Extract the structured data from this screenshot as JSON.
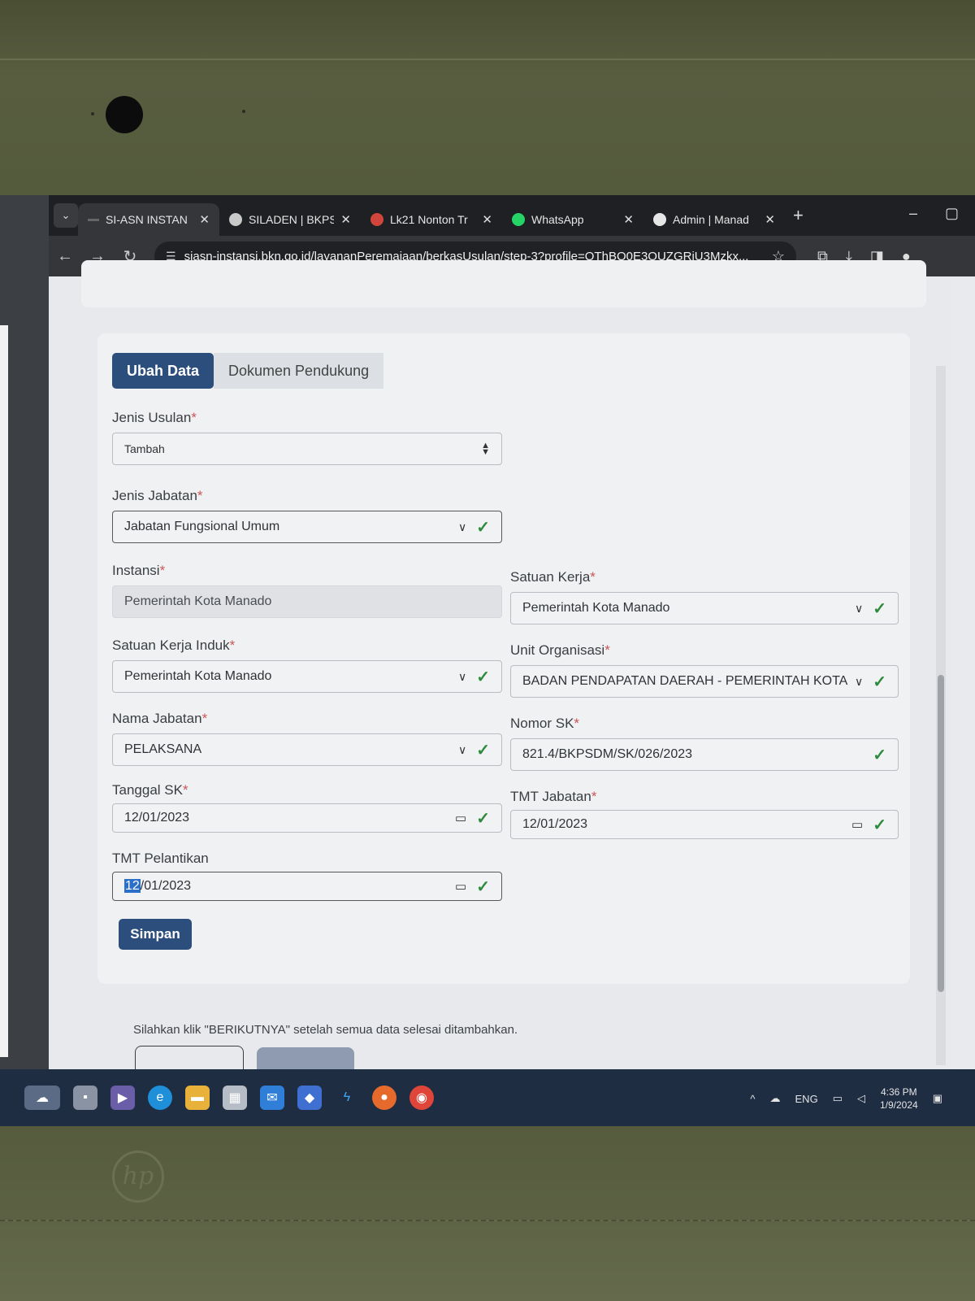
{
  "browser": {
    "tabs": [
      {
        "title": "SI-ASN INSTAN",
        "active": true,
        "favicon": "siasn-favicon"
      },
      {
        "title": "SILADEN | BKPS",
        "active": false,
        "favicon": "siladen-favicon"
      },
      {
        "title": "Lk21 Nonton Tr",
        "active": false,
        "favicon": "lk21-favicon"
      },
      {
        "title": "WhatsApp",
        "active": false,
        "favicon": "whatsapp-favicon"
      },
      {
        "title": "Admin | Manad",
        "active": false,
        "favicon": "admin-favicon"
      }
    ],
    "url": "siasn-instansi.bkn.go.id/layananPeremajaan/berkasUsulan/step-3?profile=QThBQ0E3OUZGRjU3Mzkx..."
  },
  "form": {
    "tab_active": "Ubah Data",
    "tab_inactive": "Dokumen Pendukung",
    "jenis_usulan": {
      "label": "Jenis Usulan",
      "value": "Tambah"
    },
    "jenis_jabatan": {
      "label": "Jenis Jabatan",
      "value": "Jabatan Fungsional Umum"
    },
    "instansi": {
      "label": "Instansi",
      "value": "Pemerintah Kota Manado"
    },
    "satuan_kerja": {
      "label": "Satuan Kerja",
      "value": "Pemerintah Kota Manado"
    },
    "satuan_kerja_induk": {
      "label": "Satuan Kerja Induk",
      "value": "Pemerintah Kota Manado"
    },
    "unit_organisasi": {
      "label": "Unit Organisasi",
      "value": "BADAN PENDAPATAN DAERAH - PEMERINTAH KOTA"
    },
    "nama_jabatan": {
      "label": "Nama Jabatan",
      "value": "PELAKSANA"
    },
    "nomor_sk": {
      "label": "Nomor SK",
      "value": "821.4/BKPSDM/SK/026/2023"
    },
    "tanggal_sk": {
      "label": "Tanggal SK",
      "value": "12/01/2023"
    },
    "tmt_jabatan": {
      "label": "TMT Jabatan",
      "value": "12/01/2023"
    },
    "tmt_pelantikan": {
      "label": "TMT Pelantikan",
      "value_selected": "12",
      "value_rest": "/01/2023"
    },
    "required_mark": "*",
    "save_label": "Simpan"
  },
  "footer_note": "Silahkan klik \"BERIKUTNYA\" setelah semua data selesai ditambahkan.",
  "taskbar": {
    "language": "ENG",
    "time": "4:36 PM",
    "date": "1/9/2024"
  }
}
